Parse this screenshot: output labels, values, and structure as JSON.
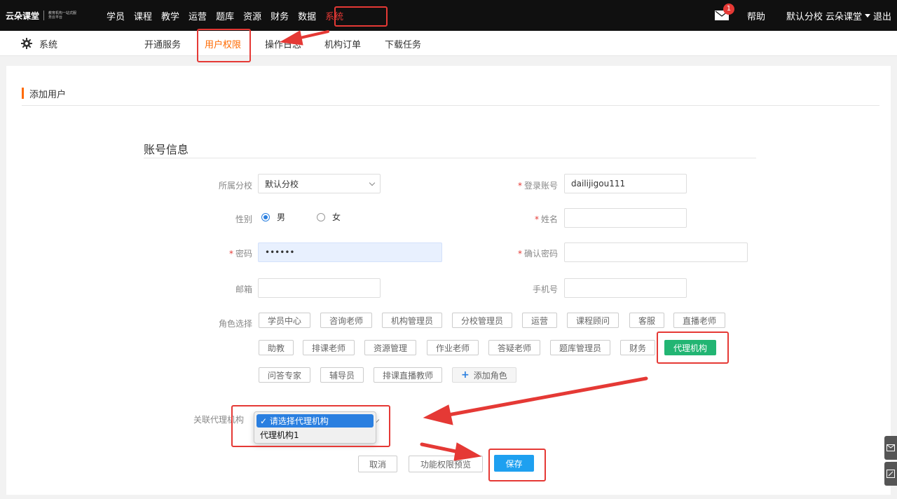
{
  "colors": {
    "topbar": "#101010",
    "accent_orange": "#ff6a00",
    "annotation_red": "#e53935",
    "role_selected": "#22b573",
    "primary": "#1ea0f0"
  },
  "logo": {
    "name": "云朵课堂",
    "tagline": "教育机构一站式服务云平台"
  },
  "nav": {
    "items": [
      "学员",
      "课程",
      "教学",
      "运营",
      "题库",
      "资源",
      "财务",
      "数据",
      "系统"
    ],
    "active": "系统"
  },
  "top_right": {
    "mail_icon": "mail-icon",
    "mail_badge": "1",
    "help": "帮助",
    "branch": "默认分校",
    "user": "云朵课堂",
    "logout": "退出"
  },
  "subnav": {
    "title": "系统",
    "title_icon": "gear-icon",
    "tabs": [
      "开通服务",
      "用户权限",
      "操作日志",
      "机构订单",
      "下载任务"
    ],
    "active": "用户权限"
  },
  "card": {
    "title": "添加用户",
    "section": "账号信息"
  },
  "form": {
    "branch": {
      "label": "所属分校",
      "value": "默认分校"
    },
    "login": {
      "label": "登录账号",
      "value": "dailijigou111"
    },
    "gender": {
      "label": "性别",
      "male": "男",
      "female": "女",
      "selected": "男"
    },
    "name": {
      "label": "姓名",
      "value": ""
    },
    "password": {
      "label": "密码",
      "value": "••••••"
    },
    "confirm": {
      "label": "确认密码",
      "value": ""
    },
    "email": {
      "label": "邮箱",
      "value": ""
    },
    "phone": {
      "label": "手机号",
      "value": ""
    },
    "roles_label": "角色选择",
    "roles": [
      "学员中心",
      "咨询老师",
      "机构管理员",
      "分校管理员",
      "运营",
      "课程顾问",
      "客服",
      "直播老师",
      "助教",
      "排课老师",
      "资源管理",
      "作业老师",
      "答疑老师",
      "题库管理员",
      "财务",
      "代理机构",
      "问答专家",
      "辅导员",
      "排课直播教师"
    ],
    "selected_role": "代理机构",
    "add_role": "添加角色",
    "agency_label": "关联代理机构",
    "agency_options": [
      "✓ 请选择代理机构",
      "代理机构1"
    ]
  },
  "buttons": {
    "cancel": "取消",
    "preview": "功能权限预览",
    "save": "保存"
  }
}
